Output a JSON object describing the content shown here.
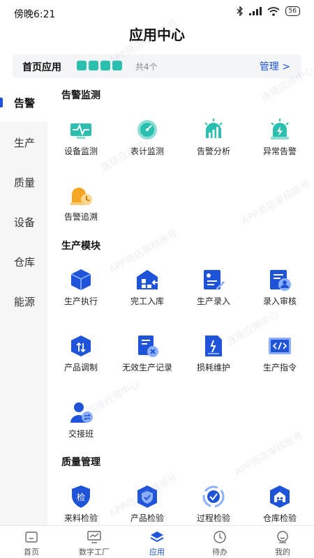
{
  "status": {
    "time": "傍晚6:21",
    "battery": "56"
  },
  "app": {
    "title": "应用中心"
  },
  "home_apps": {
    "title": "首页应用",
    "count": "共4个",
    "manage": "管理 >"
  },
  "sidebar": {
    "items": [
      {
        "label": "告警"
      },
      {
        "label": "生产"
      },
      {
        "label": "质量"
      },
      {
        "label": "设备"
      },
      {
        "label": "仓库"
      },
      {
        "label": "能源"
      }
    ]
  },
  "sections": {
    "alarm": {
      "title": "告警监测",
      "items": [
        "设备监测",
        "表计监测",
        "告警分析",
        "异常告警",
        "告警追溯"
      ]
    },
    "production": {
      "title": "生产模块",
      "items": [
        "生产执行",
        "完工入库",
        "生产录入",
        "录入审核",
        "产品调制",
        "无效生产记录",
        "损耗维护",
        "生产指令",
        "交接班"
      ]
    },
    "quality": {
      "title": "质量管理",
      "items": [
        "来料检验",
        "产品检验",
        "过程检验",
        "仓库检验"
      ]
    }
  },
  "watermark": {
    "text": "APP商店审核账号",
    "text2": "连接应用中心"
  },
  "tabbar": {
    "items": [
      {
        "label": "首页"
      },
      {
        "label": "数字工厂"
      },
      {
        "label": "应用"
      },
      {
        "label": "待办"
      },
      {
        "label": "我的"
      }
    ]
  },
  "colors": {
    "accent": "#1f54d8",
    "teal": "#2bbfb0",
    "orange": "#f5a623"
  }
}
